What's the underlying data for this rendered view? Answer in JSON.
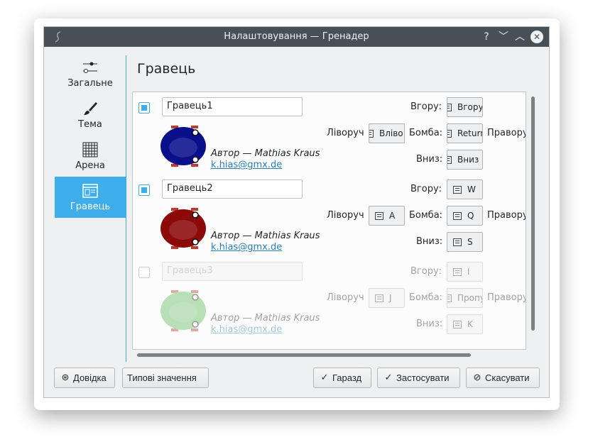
{
  "window": {
    "title": "Налаштовування — Гренадер",
    "help_glyph": "?",
    "min_glyph": "﹀",
    "max_glyph": "︿",
    "close_glyph": "✕"
  },
  "sidebar": {
    "items": [
      {
        "label": "Загальне",
        "icon": "sliders-icon"
      },
      {
        "label": "Тема",
        "icon": "brush-icon"
      },
      {
        "label": "Арена",
        "icon": "grid-icon"
      },
      {
        "label": "Гравець",
        "icon": "player-icon",
        "active": true
      }
    ]
  },
  "page": {
    "title": "Гравець"
  },
  "players": [
    {
      "enabled": true,
      "name": "Гравець1",
      "color": "#0a0f8c",
      "author": "Автор — Mathias Kraus",
      "email": "k.hias@gmx.de",
      "labels": {
        "up": "Вгору:",
        "left": "Ліворуч",
        "bomb": "Бомба:",
        "right": "Праворуч",
        "down": "Вниз:"
      },
      "keys": {
        "up": "Вгору",
        "left": "Вліво",
        "bomb": "Return",
        "down": "Вниз"
      }
    },
    {
      "enabled": true,
      "name": "Гравець2",
      "color": "#8c0a0a",
      "author": "Автор — Mathias Kraus",
      "email": "k.hias@gmx.de",
      "labels": {
        "up": "Вгору:",
        "left": "Ліворуч",
        "bomb": "Бомба:",
        "right": "Праворуч",
        "down": "Вниз:"
      },
      "keys": {
        "up": "W",
        "left": "A",
        "bomb": "Q",
        "down": "S"
      }
    },
    {
      "enabled": false,
      "name": "Гравець3",
      "color": "#5fb85a",
      "author": "Автор — Mathias Kraus",
      "email": "k.hias@gmx.de",
      "labels": {
        "up": "Вгору:",
        "left": "Ліворуч",
        "bomb": "Бомба:",
        "right": "Праворуч",
        "down": "Вниз:"
      },
      "keys": {
        "up": "I",
        "left": "J",
        "bomb": "Пропуск",
        "down": "K"
      }
    }
  ],
  "buttons": {
    "help": "Довідка",
    "defaults": "Типові значення",
    "ok": "Гаразд",
    "apply": "Застосувати",
    "cancel": "Скасувати"
  },
  "colors": {
    "accent": "#3daee9",
    "titlebar": "#475057",
    "link": "#2980b9"
  }
}
